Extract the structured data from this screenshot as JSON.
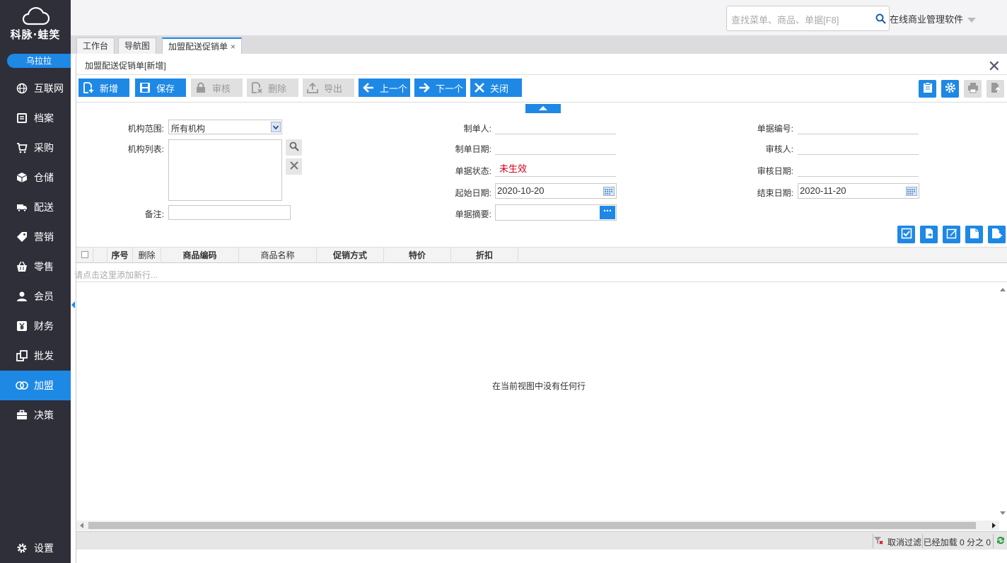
{
  "sidebar": {
    "logo_text": "科脉·蛙笑",
    "user": "乌拉拉",
    "items": [
      {
        "label": "互联网",
        "icon": "globe-icon"
      },
      {
        "label": "档案",
        "icon": "file-icon"
      },
      {
        "label": "采购",
        "icon": "cart-icon"
      },
      {
        "label": "仓储",
        "icon": "box-icon"
      },
      {
        "label": "配送",
        "icon": "truck-icon"
      },
      {
        "label": "营销",
        "icon": "tag-icon"
      },
      {
        "label": "零售",
        "icon": "basket-icon"
      },
      {
        "label": "会员",
        "icon": "user-icon"
      },
      {
        "label": "财务",
        "icon": "yen-icon"
      },
      {
        "label": "批发",
        "icon": "copy-icon"
      },
      {
        "label": "加盟",
        "icon": "rings-icon",
        "active": true
      },
      {
        "label": "决策",
        "icon": "briefcase-icon"
      }
    ],
    "settings": "设置"
  },
  "topbar": {
    "search_placeholder": "查找菜单、商品、单据[F8]",
    "system_name": "在线商业管理软件"
  },
  "tabs": [
    "工作台",
    "导航图",
    "加盟配送促销单"
  ],
  "panel": {
    "title": "加盟配送促销单[新增]",
    "buttons": {
      "new": "新增",
      "save": "保存",
      "audit": "审核",
      "delete": "删除",
      "export": "导出",
      "prev": "上一个",
      "next": "下一个",
      "close": "关闭"
    }
  },
  "form": {
    "org_scope_label": "机构范围:",
    "org_scope_value": "所有机构",
    "org_list_label": "机构列表:",
    "remark_label": "备注:",
    "maker_label": "制单人:",
    "make_date_label": "制单日期:",
    "status_label": "单据状态:",
    "status_value": "未生效",
    "status_color": "#d0021b",
    "start_date_label": "起始日期:",
    "start_date": "2020-10-20",
    "summary_label": "单据摘要:",
    "bill_no_label": "单据编号:",
    "auditor_label": "审核人:",
    "audit_date_label": "审核日期:",
    "end_date_label": "结束日期:",
    "end_date": "2020-11-20"
  },
  "grid": {
    "columns": [
      "序号",
      "删除",
      "商品编码",
      "商品名称",
      "促销方式",
      "特价",
      "折扣"
    ],
    "add_row_hint": "请点击这里添加新行...",
    "empty_text": "在当前视图中没有任何行"
  },
  "footer": {
    "cancel_filter": "取消过滤",
    "loaded": "已经加载 0 分之 0"
  },
  "colors": {
    "accent": "#1e88e5",
    "sidebar_bg": "#2f2f3a"
  }
}
